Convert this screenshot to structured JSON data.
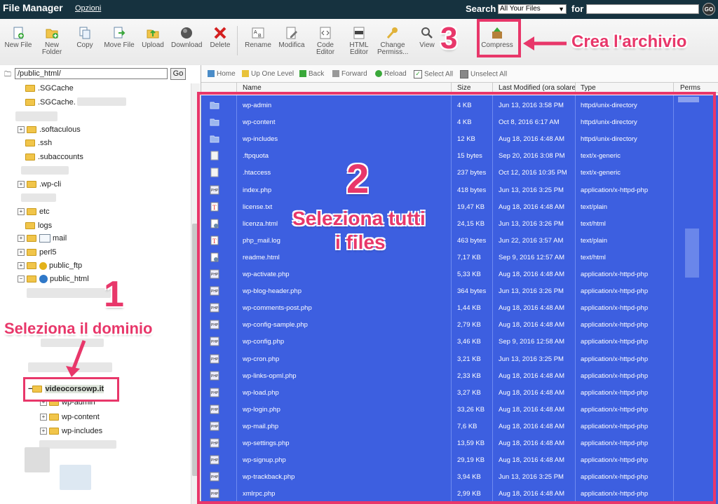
{
  "header": {
    "title": "File Manager",
    "options_link": "Opzioni",
    "search_label": "Search",
    "search_scope": "All Your Files",
    "for_label": "for",
    "search_value": "",
    "go_label": "GO"
  },
  "toolbar": {
    "new_file": "New File",
    "new_folder_1": "New",
    "new_folder_2": "Folder",
    "copy": "Copy",
    "move_file": "Move File",
    "upload": "Upload",
    "download": "Download",
    "delete": "Delete",
    "rename": "Rename",
    "modifica": "Modifica",
    "code_editor_1": "Code",
    "code_editor_2": "Editor",
    "html_editor_1": "HTML",
    "html_editor_2": "Editor",
    "change_perms_1": "Change",
    "change_perms_2": "Permiss...",
    "view": "View",
    "compress": "Compress"
  },
  "tree": {
    "path": "/public_html/",
    "go_label": "Go",
    "items": [
      ".SGCache",
      ".SGCache.",
      ".softaculous",
      ".ssh",
      ".subaccounts",
      ".wp-cli",
      "etc",
      "logs",
      "mail",
      "perl5",
      "public_ftp",
      "public_html",
      "videocorsowp.it",
      "wp-admin",
      "wp-content",
      "wp-includes"
    ]
  },
  "navbar": {
    "home": "Home",
    "up": "Up One Level",
    "back": "Back",
    "forward": "Forward",
    "reload": "Reload",
    "select_all": "Select All",
    "unselect_all": "Unselect All"
  },
  "columns": {
    "name": "Name",
    "size": "Size",
    "modified": "Last Modified (ora solare",
    "type": "Type",
    "perms": "Perms"
  },
  "files": [
    {
      "name": "wp-admin",
      "size": "4 KB",
      "modified": "Jun 13, 2016 3:58 PM",
      "type": "httpd/unix-directory",
      "kind": "folder"
    },
    {
      "name": "wp-content",
      "size": "4 KB",
      "modified": "Oct 8, 2016 6:17 AM",
      "type": "httpd/unix-directory",
      "kind": "folder"
    },
    {
      "name": "wp-includes",
      "size": "12 KB",
      "modified": "Aug 18, 2016 4:48 AM",
      "type": "httpd/unix-directory",
      "kind": "folder"
    },
    {
      "name": ".ftpquota",
      "size": "15 bytes",
      "modified": "Sep 20, 2016 3:08 PM",
      "type": "text/x-generic",
      "kind": "generic"
    },
    {
      "name": ".htaccess",
      "size": "237 bytes",
      "modified": "Oct 12, 2016 10:35 PM",
      "type": "text/x-generic",
      "kind": "generic"
    },
    {
      "name": "index.php",
      "size": "418 bytes",
      "modified": "Jun 13, 2016 3:25 PM",
      "type": "application/x-httpd-php",
      "kind": "php"
    },
    {
      "name": "license.txt",
      "size": "19,47 KB",
      "modified": "Aug 18, 2016 4:48 AM",
      "type": "text/plain",
      "kind": "text"
    },
    {
      "name": "licenza.html",
      "size": "24,15 KB",
      "modified": "Jun 13, 2016 3:26 PM",
      "type": "text/html",
      "kind": "html"
    },
    {
      "name": "php_mail.log",
      "size": "463 bytes",
      "modified": "Jun 22, 2016 3:57 AM",
      "type": "text/plain",
      "kind": "text"
    },
    {
      "name": "readme.html",
      "size": "7,17 KB",
      "modified": "Sep 9, 2016 12:57 AM",
      "type": "text/html",
      "kind": "html"
    },
    {
      "name": "wp-activate.php",
      "size": "5,33 KB",
      "modified": "Aug 18, 2016 4:48 AM",
      "type": "application/x-httpd-php",
      "kind": "php"
    },
    {
      "name": "wp-blog-header.php",
      "size": "364 bytes",
      "modified": "Jun 13, 2016 3:26 PM",
      "type": "application/x-httpd-php",
      "kind": "php"
    },
    {
      "name": "wp-comments-post.php",
      "size": "1,44 KB",
      "modified": "Aug 18, 2016 4:48 AM",
      "type": "application/x-httpd-php",
      "kind": "php"
    },
    {
      "name": "wp-config-sample.php",
      "size": "2,79 KB",
      "modified": "Aug 18, 2016 4:48 AM",
      "type": "application/x-httpd-php",
      "kind": "php"
    },
    {
      "name": "wp-config.php",
      "size": "3,46 KB",
      "modified": "Sep 9, 2016 12:58 AM",
      "type": "application/x-httpd-php",
      "kind": "php"
    },
    {
      "name": "wp-cron.php",
      "size": "3,21 KB",
      "modified": "Jun 13, 2016 3:25 PM",
      "type": "application/x-httpd-php",
      "kind": "php"
    },
    {
      "name": "wp-links-opml.php",
      "size": "2,33 KB",
      "modified": "Aug 18, 2016 4:48 AM",
      "type": "application/x-httpd-php",
      "kind": "php"
    },
    {
      "name": "wp-load.php",
      "size": "3,27 KB",
      "modified": "Aug 18, 2016 4:48 AM",
      "type": "application/x-httpd-php",
      "kind": "php"
    },
    {
      "name": "wp-login.php",
      "size": "33,26 KB",
      "modified": "Aug 18, 2016 4:48 AM",
      "type": "application/x-httpd-php",
      "kind": "php"
    },
    {
      "name": "wp-mail.php",
      "size": "7,6 KB",
      "modified": "Aug 18, 2016 4:48 AM",
      "type": "application/x-httpd-php",
      "kind": "php"
    },
    {
      "name": "wp-settings.php",
      "size": "13,59 KB",
      "modified": "Aug 18, 2016 4:48 AM",
      "type": "application/x-httpd-php",
      "kind": "php"
    },
    {
      "name": "wp-signup.php",
      "size": "29,19 KB",
      "modified": "Aug 18, 2016 4:48 AM",
      "type": "application/x-httpd-php",
      "kind": "php"
    },
    {
      "name": "wp-trackback.php",
      "size": "3,94 KB",
      "modified": "Jun 13, 2016 3:25 PM",
      "type": "application/x-httpd-php",
      "kind": "php"
    },
    {
      "name": "xmlrpc.php",
      "size": "2,99 KB",
      "modified": "Aug 18, 2016 4:48 AM",
      "type": "application/x-httpd-php",
      "kind": "php"
    }
  ],
  "annotations": {
    "step1_number": "1",
    "step1_text": "Seleziona il dominio",
    "step2_number": "2",
    "step2_line1": "Seleziona tutti",
    "step2_line2": "i files",
    "step3_number": "3",
    "step3_text": "Crea l'archivio"
  },
  "colors": {
    "accent": "#e8376a",
    "selection": "#3d5fe0",
    "header_bg": "#16323f"
  }
}
